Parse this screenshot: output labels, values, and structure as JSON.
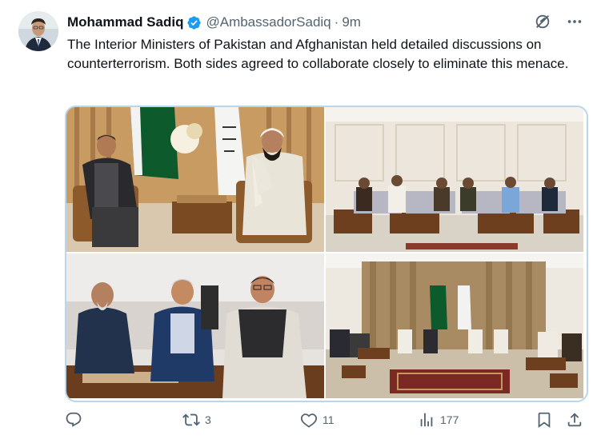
{
  "author": {
    "name": "Mohammad Sadiq",
    "handle": "@AmbassadorSadiq",
    "separator": "·",
    "time": "9m",
    "verified": true,
    "avatar_icon": "profile-photo"
  },
  "tweet": {
    "text": "The Interior Ministers of Pakistan and Afghanistan held detailed discussions on counterterrorism. Both sides agreed to collaborate closely to eliminate this menace."
  },
  "header_icons": [
    "grok-icon",
    "more-icon"
  ],
  "media": {
    "count": 4
  },
  "actions": {
    "reply": {
      "icon": "reply-icon",
      "count": ""
    },
    "retweet": {
      "icon": "retweet-icon",
      "count": "3"
    },
    "like": {
      "icon": "heart-icon",
      "count": "11"
    },
    "views": {
      "icon": "analytics-icon",
      "count": "177"
    },
    "bookmark": {
      "icon": "bookmark-icon"
    },
    "share": {
      "icon": "share-icon"
    }
  },
  "colors": {
    "verified_blue": "#1d9bf0",
    "secondary_text": "#536471",
    "primary_text": "#0f1419"
  }
}
